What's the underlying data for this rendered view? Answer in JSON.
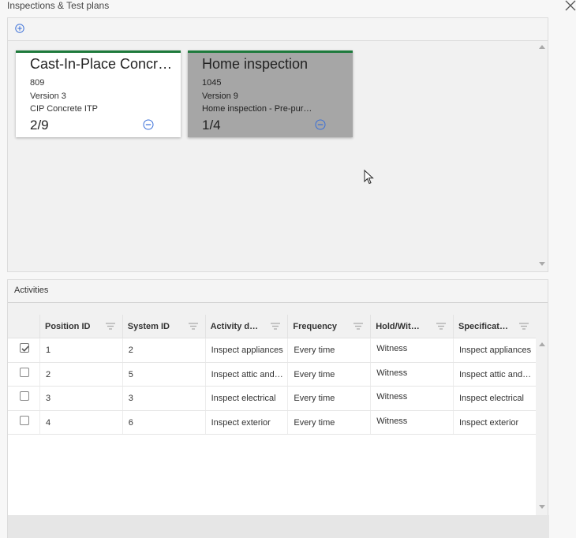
{
  "window": {
    "title": "Inspections & Test plans"
  },
  "plans": {
    "cards": [
      {
        "title": "Cast-In-Place Concrete ITP",
        "id": "809",
        "version": "Version 3",
        "description": "CIP Concrete ITP",
        "count": "2/9",
        "selected": false
      },
      {
        "title": "Home inspection",
        "id": "1045",
        "version": "Version 9",
        "description": "Home inspection - Pre-purchase",
        "count": "1/4",
        "selected": true
      }
    ]
  },
  "activities": {
    "header": "Activities",
    "columns": [
      "Position ID",
      "System ID",
      "Activity description",
      "Frequency",
      "Hold/Witness",
      "Specification"
    ],
    "rows": [
      {
        "checked": true,
        "position_id": "1",
        "system_id": "2",
        "activity": "Inspect appliances",
        "frequency": "Every time",
        "hold_witness": "Witness",
        "specification": "Inspect appliances"
      },
      {
        "checked": false,
        "position_id": "2",
        "system_id": "5",
        "activity": "Inspect attic and roof",
        "frequency": "Every time",
        "hold_witness": "Witness",
        "specification": "Inspect attic and roof"
      },
      {
        "checked": false,
        "position_id": "3",
        "system_id": "3",
        "activity": "Inspect electrical",
        "frequency": "Every time",
        "hold_witness": "Witness",
        "specification": "Inspect electrical"
      },
      {
        "checked": false,
        "position_id": "4",
        "system_id": "6",
        "activity": "Inspect exterior",
        "frequency": "Every time",
        "hold_witness": "Witness",
        "specification": "Inspect exterior"
      }
    ]
  },
  "colors": {
    "card_accent": "#1e7a3c",
    "icon_blue": "#3a6fd8",
    "selected_card_bg": "#a6a6a6"
  },
  "icons": {
    "add": "add-circle-icon",
    "remove": "remove-circle-icon",
    "filter": "filter-icon",
    "close": "close-icon"
  }
}
